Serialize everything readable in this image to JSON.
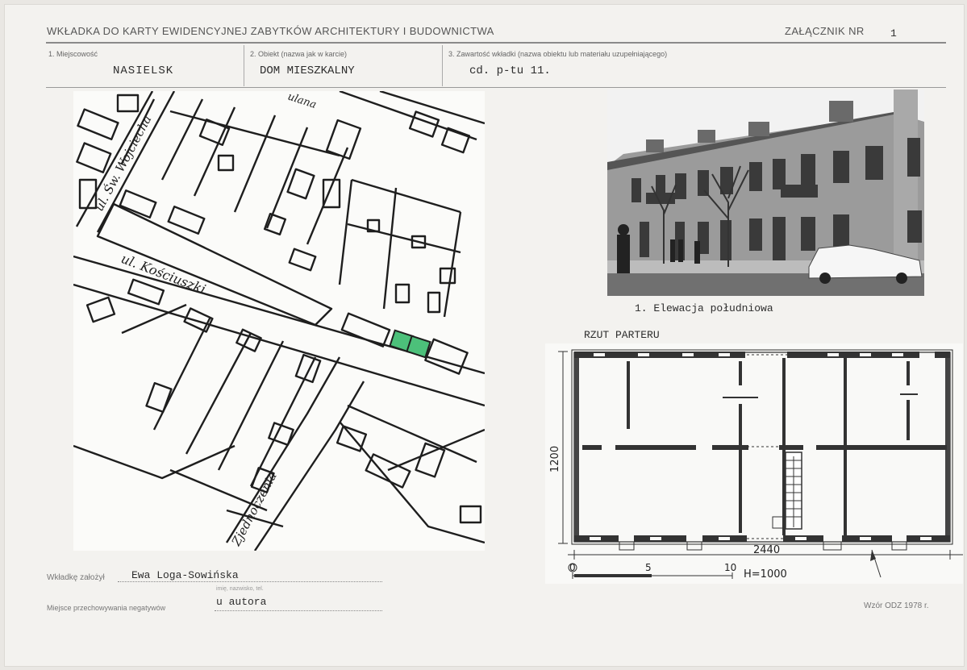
{
  "header": {
    "title": "WKŁADKA DO KARTY EWIDENCYJNEJ ZABYTKÓW ARCHITEKTURY I BUDOWNICTWA",
    "attachment_label": "ZAŁĄCZNIK NR",
    "attachment_number": "1"
  },
  "fields": {
    "locality_label": "1. Miejscowość",
    "locality_value": "NASIELSK",
    "object_label": "2. Obiekt (nazwa jak w karcie)",
    "object_value": "DOM MIESZKALNY",
    "content_label": "3. Zawartość wkładki (nazwa obiektu lub materiału uzupełniającego)",
    "content_value": "cd. p-tu 11."
  },
  "map": {
    "street_1": "ul. Św. Wojciecha",
    "street_2": "ul. Kościuszki",
    "street_3": "Zjednoczenia",
    "street_4": "ulana",
    "highlight_color": "#4cc07a"
  },
  "photo": {
    "caption": "1. Elewacja południowa"
  },
  "plan": {
    "title": "RZUT PARTERU",
    "dim_height": "1200",
    "dim_width": "2440",
    "scale_0": "0",
    "scale_5": "5",
    "scale_10": "10",
    "level": "H=1000"
  },
  "footer": {
    "author_label": "Wkładkę założył",
    "author_value": "Ewa Loga-Sowińska",
    "author_sub": "imię, nazwisko, tel.",
    "negatives_label": "Miejsce przechowywania negatywów",
    "negatives_value": "u autora",
    "form_code": "Wzór ODZ 1978 r."
  }
}
